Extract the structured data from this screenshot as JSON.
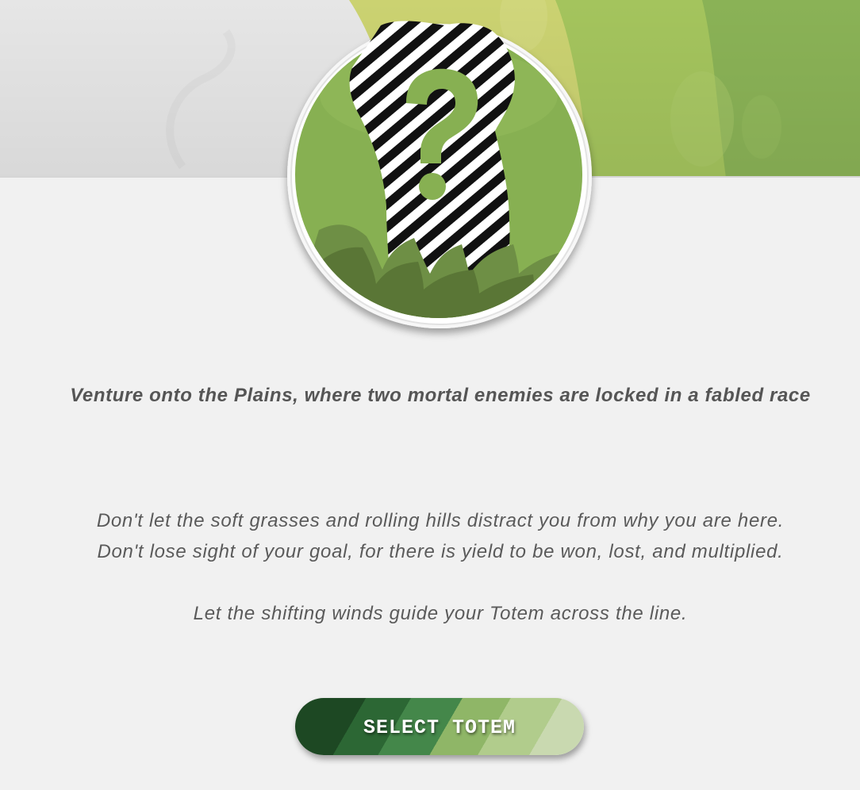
{
  "banner": {
    "left_color": "#e6e6e6",
    "right_colors": [
      "#cbd271",
      "#a4c45d",
      "#8ab256"
    ]
  },
  "emblem": {
    "icon": "question-mark-totem-icon",
    "disc_color": "#87b052",
    "grass_color": "#5d7a3a"
  },
  "content": {
    "subtitle": "Venture onto the Plains, where two mortal enemies are locked in a fabled race",
    "paragraph_1": "Don't let the soft grasses and rolling hills distract you from why you are here.",
    "paragraph_2": "Don't lose sight of your goal, for there is yield to be won, lost, and multiplied.",
    "paragraph_3": "Let the shifting winds guide your Totem across the line."
  },
  "actions": {
    "select_totem_label": "SELECT TOTEM",
    "button_colors": [
      "#1d4823",
      "#2c6734",
      "#44874a",
      "#8fb667",
      "#b1cc8c",
      "#c9d9b0"
    ]
  }
}
